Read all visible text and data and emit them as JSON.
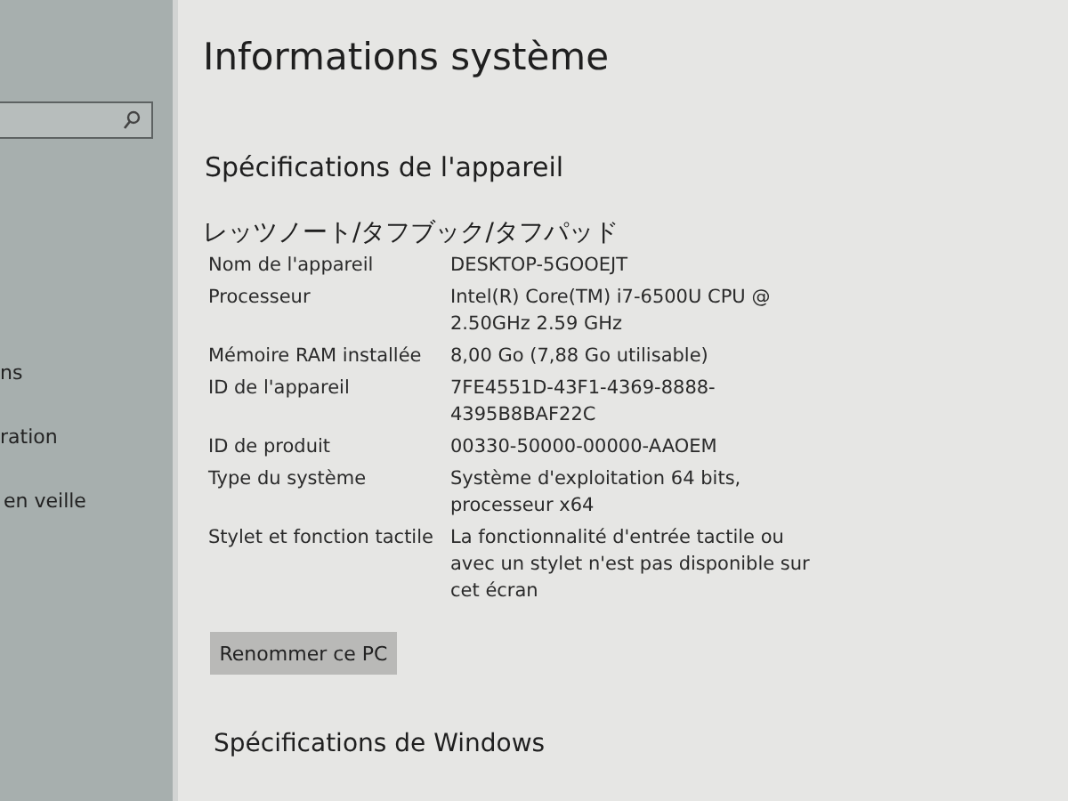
{
  "sidebar": {
    "items": [
      {
        "label": "ns"
      },
      {
        "label": "ration"
      },
      {
        "label": "en veille"
      }
    ]
  },
  "page": {
    "title": "Informations système",
    "device_section": {
      "heading": "Spécifications de l'appareil",
      "device_model": "レッツノート/タフブック/タフパッド",
      "rows": [
        {
          "label": "Nom de l'appareil",
          "value": "DESKTOP-5GOOEJT"
        },
        {
          "label": "Processeur",
          "value": "Intel(R) Core(TM) i7-6500U CPU @ 2.50GHz   2.59 GHz"
        },
        {
          "label": "Mémoire RAM installée",
          "value": "8,00 Go (7,88 Go utilisable)"
        },
        {
          "label": "ID de l'appareil",
          "value": "7FE4551D-43F1-4369-8888-4395B8BAF22C"
        },
        {
          "label": "ID de produit",
          "value": "00330-50000-00000-AAOEM"
        },
        {
          "label": "Type du système",
          "value": "Système d'exploitation 64 bits, processeur x64"
        },
        {
          "label": "Stylet et fonction tactile",
          "value": "La fonctionnalité d'entrée tactile ou avec un stylet n'est pas disponible sur cet écran"
        }
      ],
      "rename_button": "Renommer ce PC"
    },
    "next_section_heading": "Spécifications de Windows"
  }
}
